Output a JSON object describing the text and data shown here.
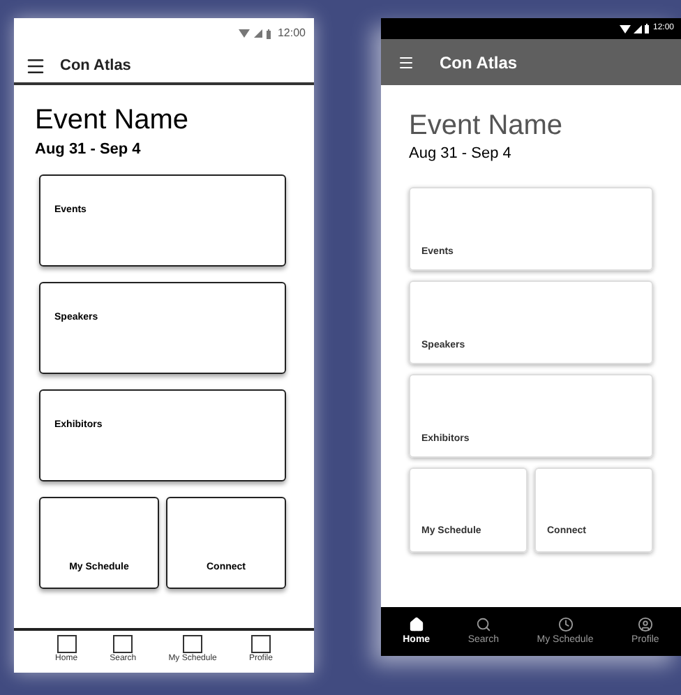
{
  "screens": [
    {
      "kind": "wireframe",
      "status_time": "12:00",
      "app_title": "Con Atlas",
      "event_name": "Event Name",
      "dates": "Aug 31 - Sep 4",
      "cards": [
        {
          "label": "Events",
          "kind": "wide"
        },
        {
          "label": "Speakers",
          "kind": "wide"
        },
        {
          "label": "Exhibitors",
          "kind": "wide"
        },
        {
          "label": "My Schedule",
          "kind": "half"
        },
        {
          "label": "Connect",
          "kind": "half"
        }
      ],
      "nav": [
        {
          "label": "Home"
        },
        {
          "label": "Search"
        },
        {
          "label": "My Schedule"
        },
        {
          "label": "Profile"
        }
      ]
    },
    {
      "kind": "mockup",
      "status_time": "12:00",
      "app_title": "Con Atlas",
      "event_name": "Event Name",
      "dates": "Aug 31 - Sep 4",
      "cards": [
        {
          "label": "Events",
          "kind": "wide"
        },
        {
          "label": "Speakers",
          "kind": "wide"
        },
        {
          "label": "Exhibitors",
          "kind": "wide"
        },
        {
          "label": "My Schedule",
          "kind": "half"
        },
        {
          "label": "Connect",
          "kind": "half"
        }
      ],
      "nav": [
        {
          "label": "Home",
          "kind": "home",
          "selected": true
        },
        {
          "label": "Search",
          "kind": "search",
          "selected": false
        },
        {
          "label": "My Schedule",
          "kind": "clock",
          "selected": false
        },
        {
          "label": "Profile",
          "kind": "profile",
          "selected": false
        }
      ]
    }
  ]
}
